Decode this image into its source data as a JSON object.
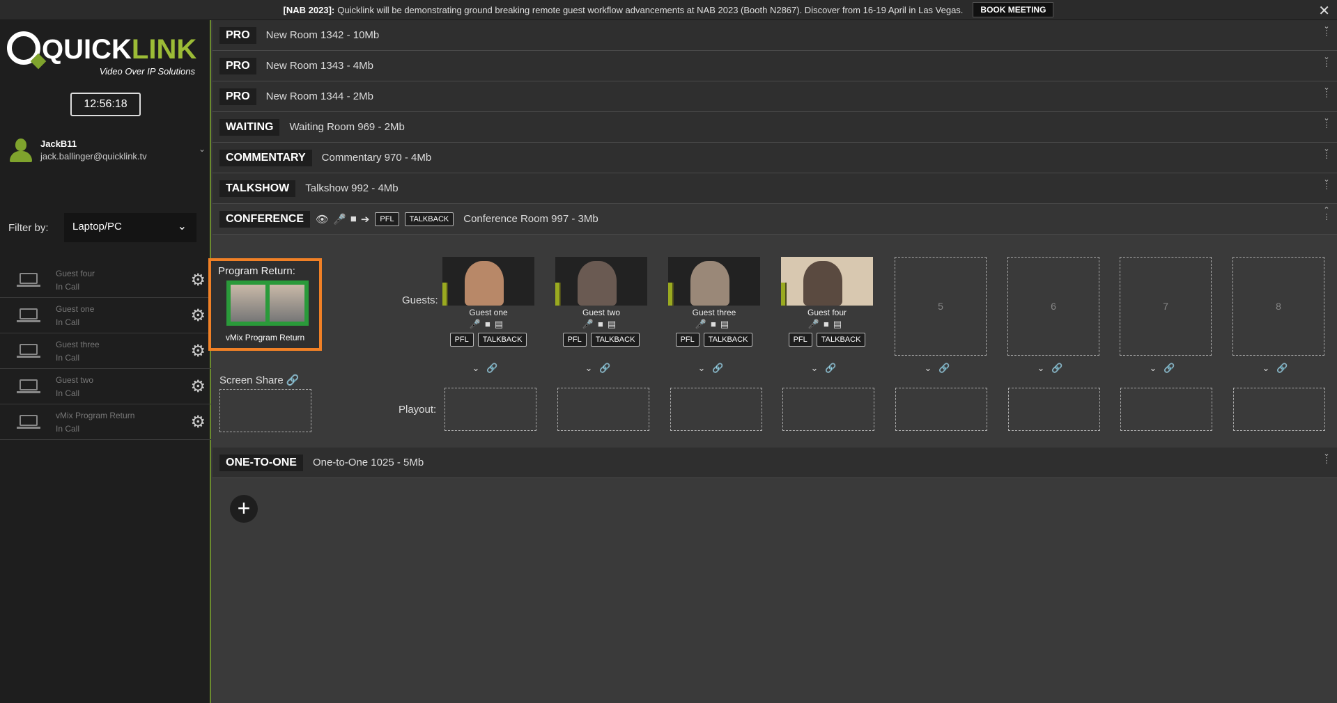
{
  "banner": {
    "tag": "[NAB 2023]:",
    "text": "Quicklink will be demonstrating ground breaking remote guest workflow advancements at NAB 2023 (Booth N2867). Discover from 16-19 April in Las Vegas.",
    "button": "BOOK MEETING",
    "close": "✕"
  },
  "logo": {
    "word_a": "QUICK",
    "word_b": "LINK",
    "tagline": "Video Over IP Solutions"
  },
  "clock": "12:56:18",
  "user": {
    "name": "JackB11",
    "email": "jack.ballinger@quicklink.tv",
    "chevron": "⌄"
  },
  "filter": {
    "label": "Filter by:",
    "value": "Laptop/PC",
    "arrow": "⌄"
  },
  "guest_list": [
    {
      "name": "Guest four",
      "status": "In Call"
    },
    {
      "name": "Guest one",
      "status": "In Call"
    },
    {
      "name": "Guest three",
      "status": "In Call"
    },
    {
      "name": "Guest two",
      "status": "In Call"
    },
    {
      "name": "vMix Program Return",
      "status": "In Call"
    }
  ],
  "rooms": [
    {
      "type": "PRO",
      "name": "New Room 1342 - 10Mb"
    },
    {
      "type": "PRO",
      "name": "New Room 1343 - 4Mb"
    },
    {
      "type": "PRO",
      "name": "New Room 1344 - 2Mb"
    },
    {
      "type": "WAITING",
      "name": "Waiting Room 969 - 2Mb"
    },
    {
      "type": "COMMENTARY",
      "name": "Commentary 970 - 4Mb"
    },
    {
      "type": "TALKSHOW",
      "name": "Talkshow 992 - 4Mb"
    },
    {
      "type": "CONFERENCE",
      "name": "Conference Room 997 - 3Mb",
      "pfl": "PFL",
      "talkback": "TALKBACK"
    },
    {
      "type": "ONE-TO-ONE",
      "name": "One-to-One 1025 - 5Mb"
    }
  ],
  "conference": {
    "program_return_label": "Program Return:",
    "program_return_caption": "vMix Program Return",
    "guests_label": "Guests:",
    "guests": [
      {
        "name": "Guest one",
        "pfl": "PFL",
        "talkback": "TALKBACK"
      },
      {
        "name": "Guest two",
        "pfl": "PFL",
        "talkback": "TALKBACK"
      },
      {
        "name": "Guest three",
        "pfl": "PFL",
        "talkback": "TALKBACK"
      },
      {
        "name": "Guest four",
        "pfl": "PFL",
        "talkback": "TALKBACK"
      }
    ],
    "empty_slots": [
      "5",
      "6",
      "7",
      "8"
    ],
    "screen_share_label": "Screen Share",
    "playout_label": "Playout:"
  },
  "add_button": "+",
  "colors": {
    "accent": "#9cbc36",
    "highlight": "#f08026",
    "background": "#3a3a3a",
    "sidebar": "#1e1e1e"
  }
}
